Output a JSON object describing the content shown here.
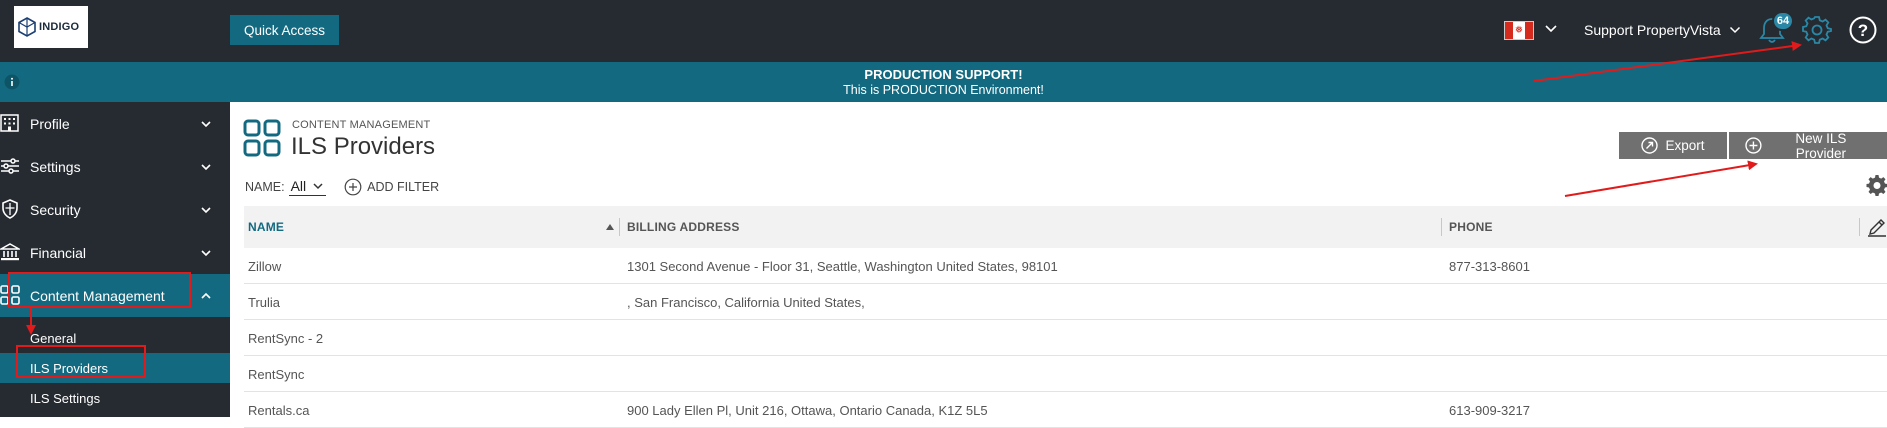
{
  "header": {
    "logo_text": "INDIGO",
    "quick_access_label": "Quick Access",
    "user_name": "Support PropertyVista",
    "notification_count": "64",
    "icons": [
      "canada-flag-icon",
      "bell-icon",
      "gear-icon",
      "help-icon"
    ]
  },
  "banner": {
    "title": "PRODUCTION SUPPORT!",
    "subtitle": "This is PRODUCTION Environment!"
  },
  "sidebar": {
    "items": [
      {
        "label": "Profile",
        "icon": "building-icon"
      },
      {
        "label": "Settings",
        "icon": "sliders-icon"
      },
      {
        "label": "Security",
        "icon": "shield-icon"
      },
      {
        "label": "Financial",
        "icon": "bank-icon"
      },
      {
        "label": "Content Management",
        "icon": "grid-icon"
      }
    ],
    "sub_items": [
      {
        "label": "General"
      },
      {
        "label": "ILS Providers"
      },
      {
        "label": "ILS Settings"
      }
    ]
  },
  "main": {
    "breadcrumb": "CONTENT MANAGEMENT",
    "title": "ILS Providers",
    "export_label": "Export",
    "new_label": "New ILS Provider",
    "filter": {
      "name_label": "NAME:",
      "selected": "All",
      "add_filter_label": "ADD FILTER"
    },
    "table": {
      "columns": [
        "NAME",
        "BILLING ADDRESS",
        "PHONE"
      ],
      "rows": [
        {
          "name": "Zillow",
          "address": "1301 Second Avenue - Floor 31, Seattle, Washington United States, 98101",
          "phone": "877-313-8601"
        },
        {
          "name": "Trulia",
          "address": ", San Francisco, California United States,",
          "phone": ""
        },
        {
          "name": "RentSync - 2",
          "address": "",
          "phone": ""
        },
        {
          "name": "RentSync",
          "address": "",
          "phone": ""
        },
        {
          "name": "Rentals.ca",
          "address": "900 Lady Ellen Pl, Unit 216, Ottawa, Ontario Canada, K1Z 5L5",
          "phone": "613-909-3217"
        }
      ]
    }
  },
  "colors": {
    "topbar": "#262b31",
    "accent": "#136a80",
    "button_gray": "#707070",
    "annotation_red": "#e11b1b"
  }
}
